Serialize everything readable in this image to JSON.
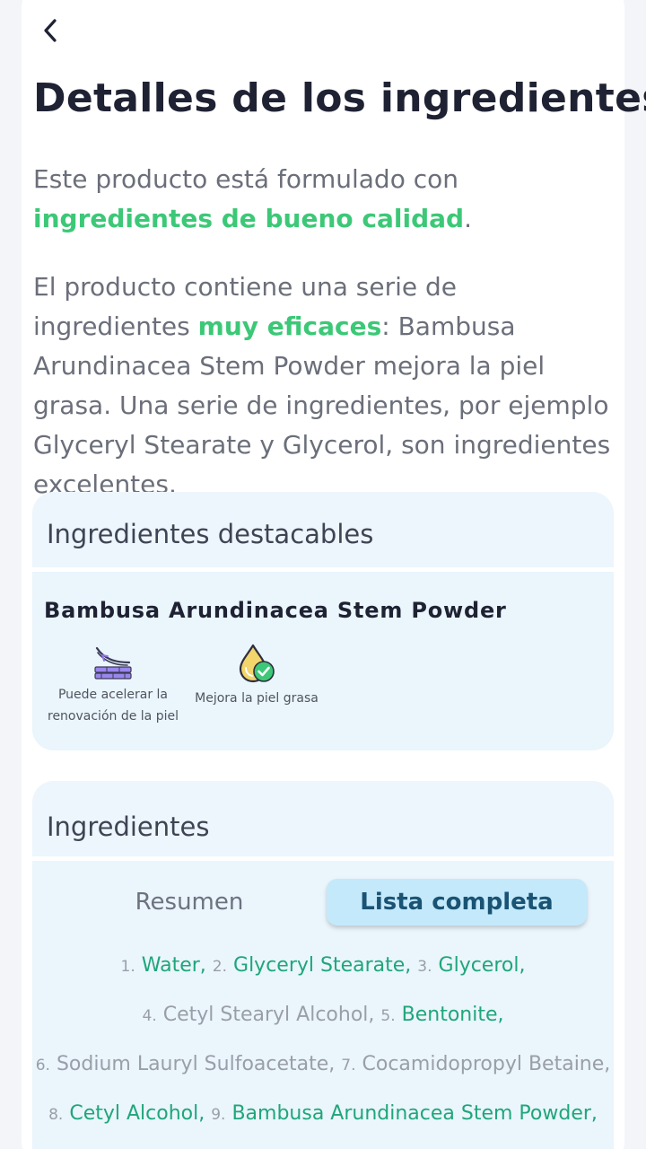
{
  "header": {
    "back_icon": "chevron-left-icon",
    "title": "Detalles de los ingredientes"
  },
  "intro": {
    "text_before": "Este producto está formulado con ",
    "highlight": "ingredientes de bueno calidad",
    "text_after": "."
  },
  "description": {
    "text_before": "El producto contiene una serie de ingredientes ",
    "highlight": "muy eficaces",
    "text_after": ": Bambusa Arundinacea Stem Powder mejora la piel grasa. Una serie de ingredientes, por ejemplo Glyceryl Stearate y Glycerol, son ingredientes excelentes."
  },
  "featured": {
    "title": "Ingredientes destacables",
    "ingredient_name": "Bambusa Arundinacea Stem Powder",
    "benefits": [
      {
        "icon": "skin-renewal-icon",
        "label_line1": "Puede acelerar la",
        "label_line2": "renovación de la piel"
      },
      {
        "icon": "oil-drop-check-icon",
        "label_line1": "Mejora la piel grasa",
        "label_line2": ""
      }
    ]
  },
  "ingredients": {
    "title": "Ingredientes",
    "tabs": {
      "summary": "Resumen",
      "full": "Lista completa",
      "active": "full"
    },
    "items": [
      {
        "num": "1.",
        "name": "Water,",
        "good": true
      },
      {
        "num": "2.",
        "name": "Glyceryl Stearate,",
        "good": true
      },
      {
        "num": "3.",
        "name": "Glycerol,",
        "good": true
      },
      {
        "num": "4.",
        "name": "Cetyl Stearyl Alcohol,",
        "good": false
      },
      {
        "num": "5.",
        "name": "Bentonite,",
        "good": true
      },
      {
        "num": "6.",
        "name": "Sodium Lauryl Sulfoacetate,",
        "good": false
      },
      {
        "num": "7.",
        "name": "Cocamidopropyl Betaine,",
        "good": false
      },
      {
        "num": "8.",
        "name": "Cetyl Alcohol,",
        "good": true
      },
      {
        "num": "9.",
        "name": "Bambusa Arundinacea Stem Powder,",
        "good": true
      }
    ]
  },
  "colors": {
    "highlight_green": "#3cc877",
    "good_ingredient": "#1fa67a",
    "neutral_ingredient": "#9a9ea8",
    "active_tab_bg": "#c4e9fb",
    "section_bg": "#eef7fd"
  }
}
